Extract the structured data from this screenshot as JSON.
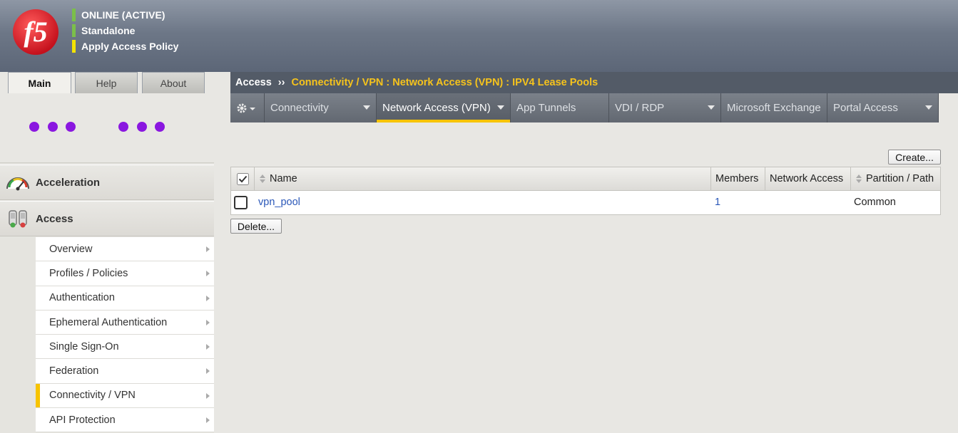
{
  "banner": {
    "logo_text": "f5",
    "status": [
      {
        "label": "ONLINE (ACTIVE)",
        "color": "#7bbf4a"
      },
      {
        "label": "Standalone",
        "color": "#7bbf4a"
      },
      {
        "label": "Apply Access Policy",
        "color": "#f3e300"
      }
    ]
  },
  "main_tabs": [
    "Main",
    "Help",
    "About"
  ],
  "sidebar": {
    "sections": [
      {
        "label": "Acceleration",
        "icon": "gauge-icon"
      },
      {
        "label": "Access",
        "icon": "access-icon"
      }
    ],
    "submenu": [
      {
        "label": "Overview"
      },
      {
        "label": "Profiles / Policies"
      },
      {
        "label": "Authentication"
      },
      {
        "label": "Ephemeral Authentication"
      },
      {
        "label": "Single Sign-On"
      },
      {
        "label": "Federation"
      },
      {
        "label": "Connectivity / VPN",
        "active": true
      },
      {
        "label": "API Protection"
      }
    ]
  },
  "breadcrumb": {
    "root": "Access",
    "separator": "››",
    "path": "Connectivity / VPN : Network Access (VPN) : IPV4 Lease Pools"
  },
  "subnav": [
    {
      "label": "Connectivity",
      "dropdown": true
    },
    {
      "label": "Network Access (VPN)",
      "dropdown": true,
      "active": true
    },
    {
      "label": "App Tunnels",
      "dropdown": false
    },
    {
      "label": "VDI / RDP",
      "dropdown": true
    },
    {
      "label": "Microsoft Exchange",
      "dropdown": false
    },
    {
      "label": "Portal Access",
      "dropdown": true
    }
  ],
  "buttons": {
    "create": "Create...",
    "delete": "Delete..."
  },
  "table": {
    "columns": [
      "Name",
      "Members",
      "Network Access",
      "Partition / Path"
    ],
    "rows": [
      {
        "name": "vpn_pool",
        "members": "1",
        "network_access": "",
        "partition": "Common"
      }
    ]
  }
}
